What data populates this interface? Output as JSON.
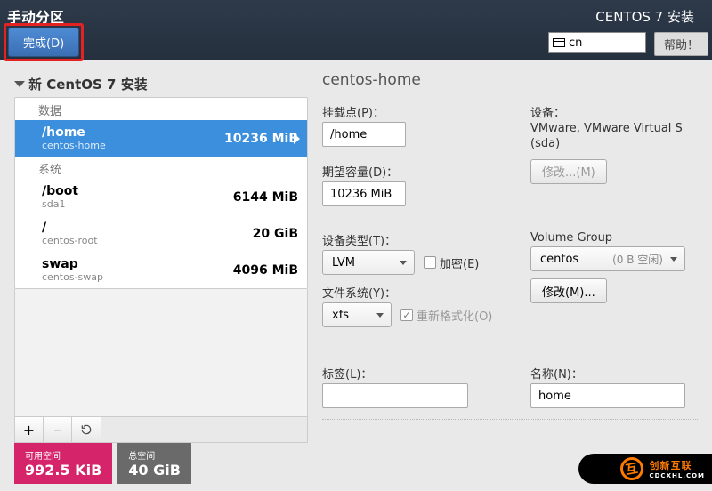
{
  "topbar": {
    "title_left": "手动分区",
    "done_label": "完成(D)",
    "title_right": "CENTOS 7 安装",
    "lang_code": "cn",
    "help_label": "帮助！"
  },
  "tree": {
    "header": "新 CentOS 7 安装",
    "cat_data": "数据",
    "cat_system": "系统",
    "items": [
      {
        "mount": "/home",
        "dev": "centos-home",
        "size": "10236 MiB",
        "selected": true
      },
      {
        "mount": "/boot",
        "dev": "sda1",
        "size": "6144 MiB",
        "selected": false
      },
      {
        "mount": "/",
        "dev": "centos-root",
        "size": "20 GiB",
        "selected": false
      },
      {
        "mount": "swap",
        "dev": "centos-swap",
        "size": "4096 MiB",
        "selected": false
      }
    ],
    "btn_add": "+",
    "btn_remove": "–"
  },
  "form": {
    "heading": "centos-home",
    "mountpoint_label": "挂载点(P)：",
    "mountpoint_value": "/home",
    "capacity_label": "期望容量(D)：",
    "capacity_value": "10236 MiB",
    "device_label": "设备：",
    "device_text_l1": "VMware, VMware Virtual S",
    "device_text_l2": "(sda)",
    "modify_device_label": "修改...(M)",
    "devtype_label": "设备类型(T)：",
    "devtype_value": "LVM",
    "encrypt_label": "加密(E)",
    "vg_label": "Volume Group",
    "vg_value": "centos",
    "vg_free": "(0 B 空闲)",
    "vg_modify_label": "修改(M)...",
    "fs_label": "文件系统(Y)：",
    "fs_value": "xfs",
    "reformat_label": "重新格式化(O)",
    "tag_label": "标签(L)：",
    "tag_value": "",
    "name_label": "名称(N)：",
    "name_value": "home"
  },
  "summary": {
    "avail_title": "可用空间",
    "avail_value": "992.5 KiB",
    "total_title": "总空间",
    "total_value": "40 GiB"
  },
  "watermark": {
    "text": "创新互联",
    "sub": "CDCXHL.COM"
  }
}
